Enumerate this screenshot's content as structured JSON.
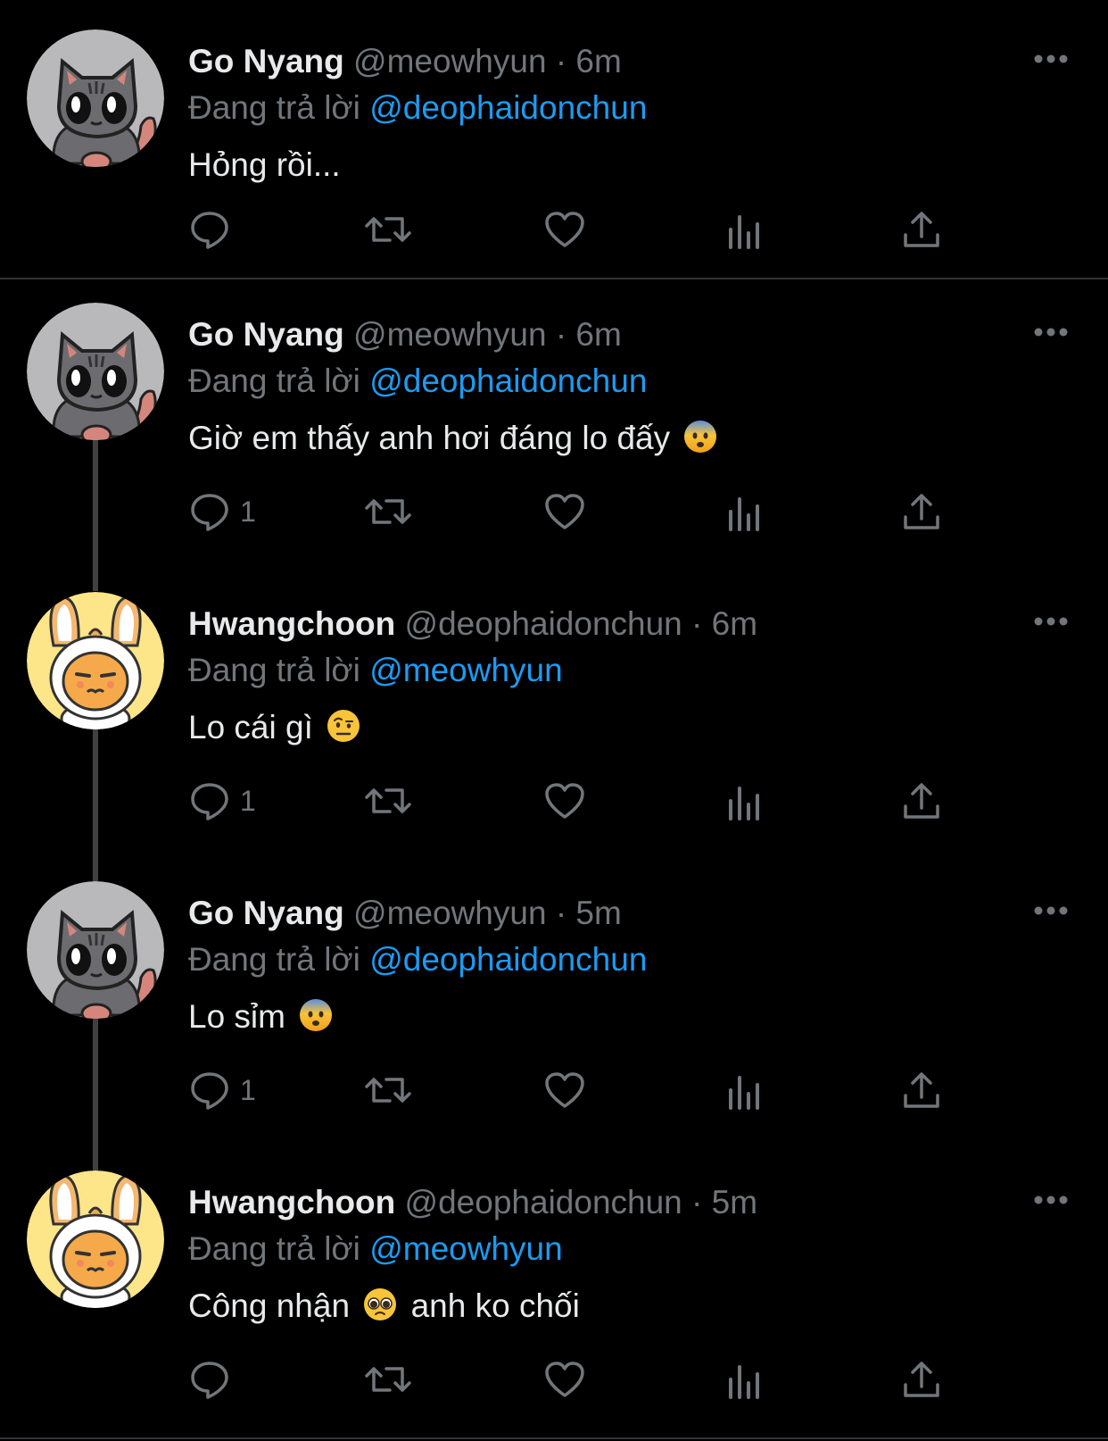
{
  "colors": {
    "background": "#000000",
    "name": "#e7e9ea",
    "muted": "#71767b",
    "mention": "#1d9bf0",
    "divider": "#2f3336"
  },
  "labels": {
    "replying_to": "Đang trả lời",
    "separator": "·"
  },
  "tweets": [
    {
      "avatar": "gray-cat-avatar",
      "name": "Go Nyang",
      "handle": "@meowhyun",
      "time": "6m",
      "reply_to": "@deophaidonchun",
      "text": "Hỏng rồi...",
      "emoji": "",
      "text_after": "",
      "reply_count": ""
    },
    {
      "avatar": "gray-cat-avatar",
      "name": "Go Nyang",
      "handle": "@meowhyun",
      "time": "6m",
      "reply_to": "@deophaidonchun",
      "text": "Giờ em thấy anh hơi đáng lo đấy",
      "emoji": "anxious-face-emoji",
      "text_after": "",
      "reply_count": "1"
    },
    {
      "avatar": "chick-bunny-avatar",
      "name": "Hwangchoon",
      "handle": "@deophaidonchun",
      "time": "6m",
      "reply_to": "@meowhyun",
      "text": "Lo cái gì",
      "emoji": "raised-eyebrow-emoji",
      "text_after": "",
      "reply_count": "1"
    },
    {
      "avatar": "gray-cat-avatar",
      "name": "Go Nyang",
      "handle": "@meowhyun",
      "time": "5m",
      "reply_to": "@deophaidonchun",
      "text": "Lo sỉm",
      "emoji": "anxious-face-emoji",
      "text_after": "",
      "reply_count": "1"
    },
    {
      "avatar": "chick-bunny-avatar",
      "name": "Hwangchoon",
      "handle": "@deophaidonchun",
      "time": "5m",
      "reply_to": "@meowhyun",
      "text": "Công nhận",
      "emoji": "pleading-face-emoji",
      "text_after": "anh ko chối",
      "reply_count": ""
    }
  ]
}
